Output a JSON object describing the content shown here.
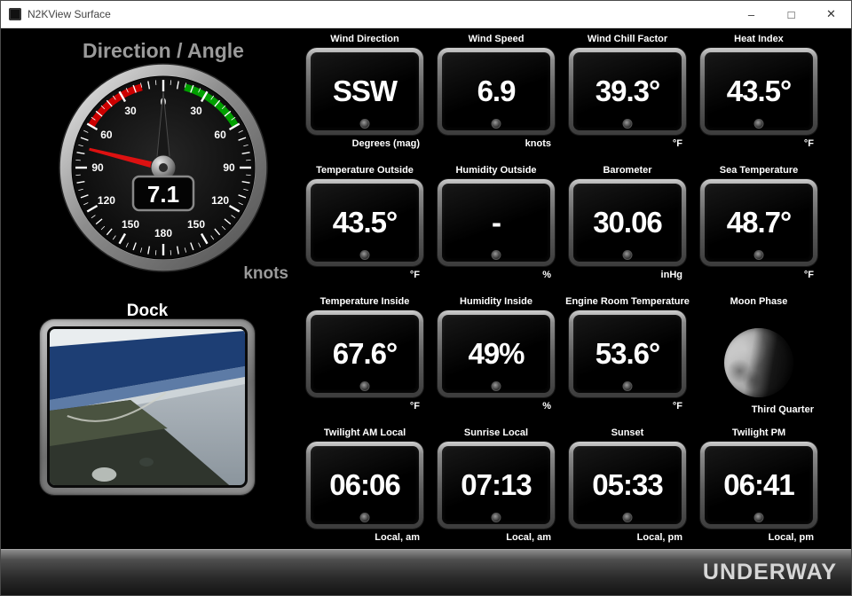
{
  "window": {
    "title": "N2KView Surface",
    "minimize_glyph": "–",
    "maximize_glyph": "□",
    "close_glyph": "✕"
  },
  "gauge": {
    "title": "Direction / Angle",
    "value": "7.1",
    "unit_label": "knots",
    "needle_angle": -76,
    "needle_color": "#dd1111",
    "port_arc_color": "#cc0000",
    "starboard_arc_color": "#00a000",
    "tick_labels": [
      {
        "angle": 0,
        "text": "0"
      },
      {
        "angle": 30,
        "text": "30"
      },
      {
        "angle": 60,
        "text": "60"
      },
      {
        "angle": 90,
        "text": "90"
      },
      {
        "angle": 120,
        "text": "120"
      },
      {
        "angle": 150,
        "text": "150"
      },
      {
        "angle": 180,
        "text": "180"
      },
      {
        "angle": -30,
        "text": "30"
      },
      {
        "angle": -60,
        "text": "60"
      },
      {
        "angle": -90,
        "text": "90"
      },
      {
        "angle": -120,
        "text": "120"
      },
      {
        "angle": -150,
        "text": "150"
      }
    ]
  },
  "camera": {
    "title": "Dock"
  },
  "instruments": [
    {
      "label": "Wind Direction",
      "value": "SSW",
      "unit": "Degrees (mag)"
    },
    {
      "label": "Wind Speed",
      "value": "6.9",
      "unit": "knots"
    },
    {
      "label": "Wind Chill Factor",
      "value": "39.3°",
      "unit": "°F"
    },
    {
      "label": "Heat Index",
      "value": "43.5°",
      "unit": "°F"
    },
    {
      "label": "Temperature Outside",
      "value": "43.5°",
      "unit": "°F"
    },
    {
      "label": "Humidity Outside",
      "value": "-",
      "unit": "%"
    },
    {
      "label": "Barometer",
      "value": "30.06",
      "unit": "inHg"
    },
    {
      "label": "Sea Temperature",
      "value": "48.7°",
      "unit": "°F"
    },
    {
      "label": "Temperature Inside",
      "value": "67.6°",
      "unit": "°F"
    },
    {
      "label": "Humidity Inside",
      "value": "49%",
      "unit": "%"
    },
    {
      "label": "Engine Room Temperature",
      "value": "53.6°",
      "unit": "°F"
    },
    {
      "label": "Moon Phase",
      "value": "",
      "unit": "Third Quarter",
      "type": "moon"
    },
    {
      "label": "Twilight AM Local",
      "value": "06:06",
      "unit": "Local, am"
    },
    {
      "label": "Sunrise Local",
      "value": "07:13",
      "unit": "Local, am"
    },
    {
      "label": "Sunset",
      "value": "05:33",
      "unit": "Local, pm"
    },
    {
      "label": "Twilight PM",
      "value": "06:41",
      "unit": "Local, pm"
    }
  ],
  "statusbar": {
    "text": "UNDERWAY"
  }
}
